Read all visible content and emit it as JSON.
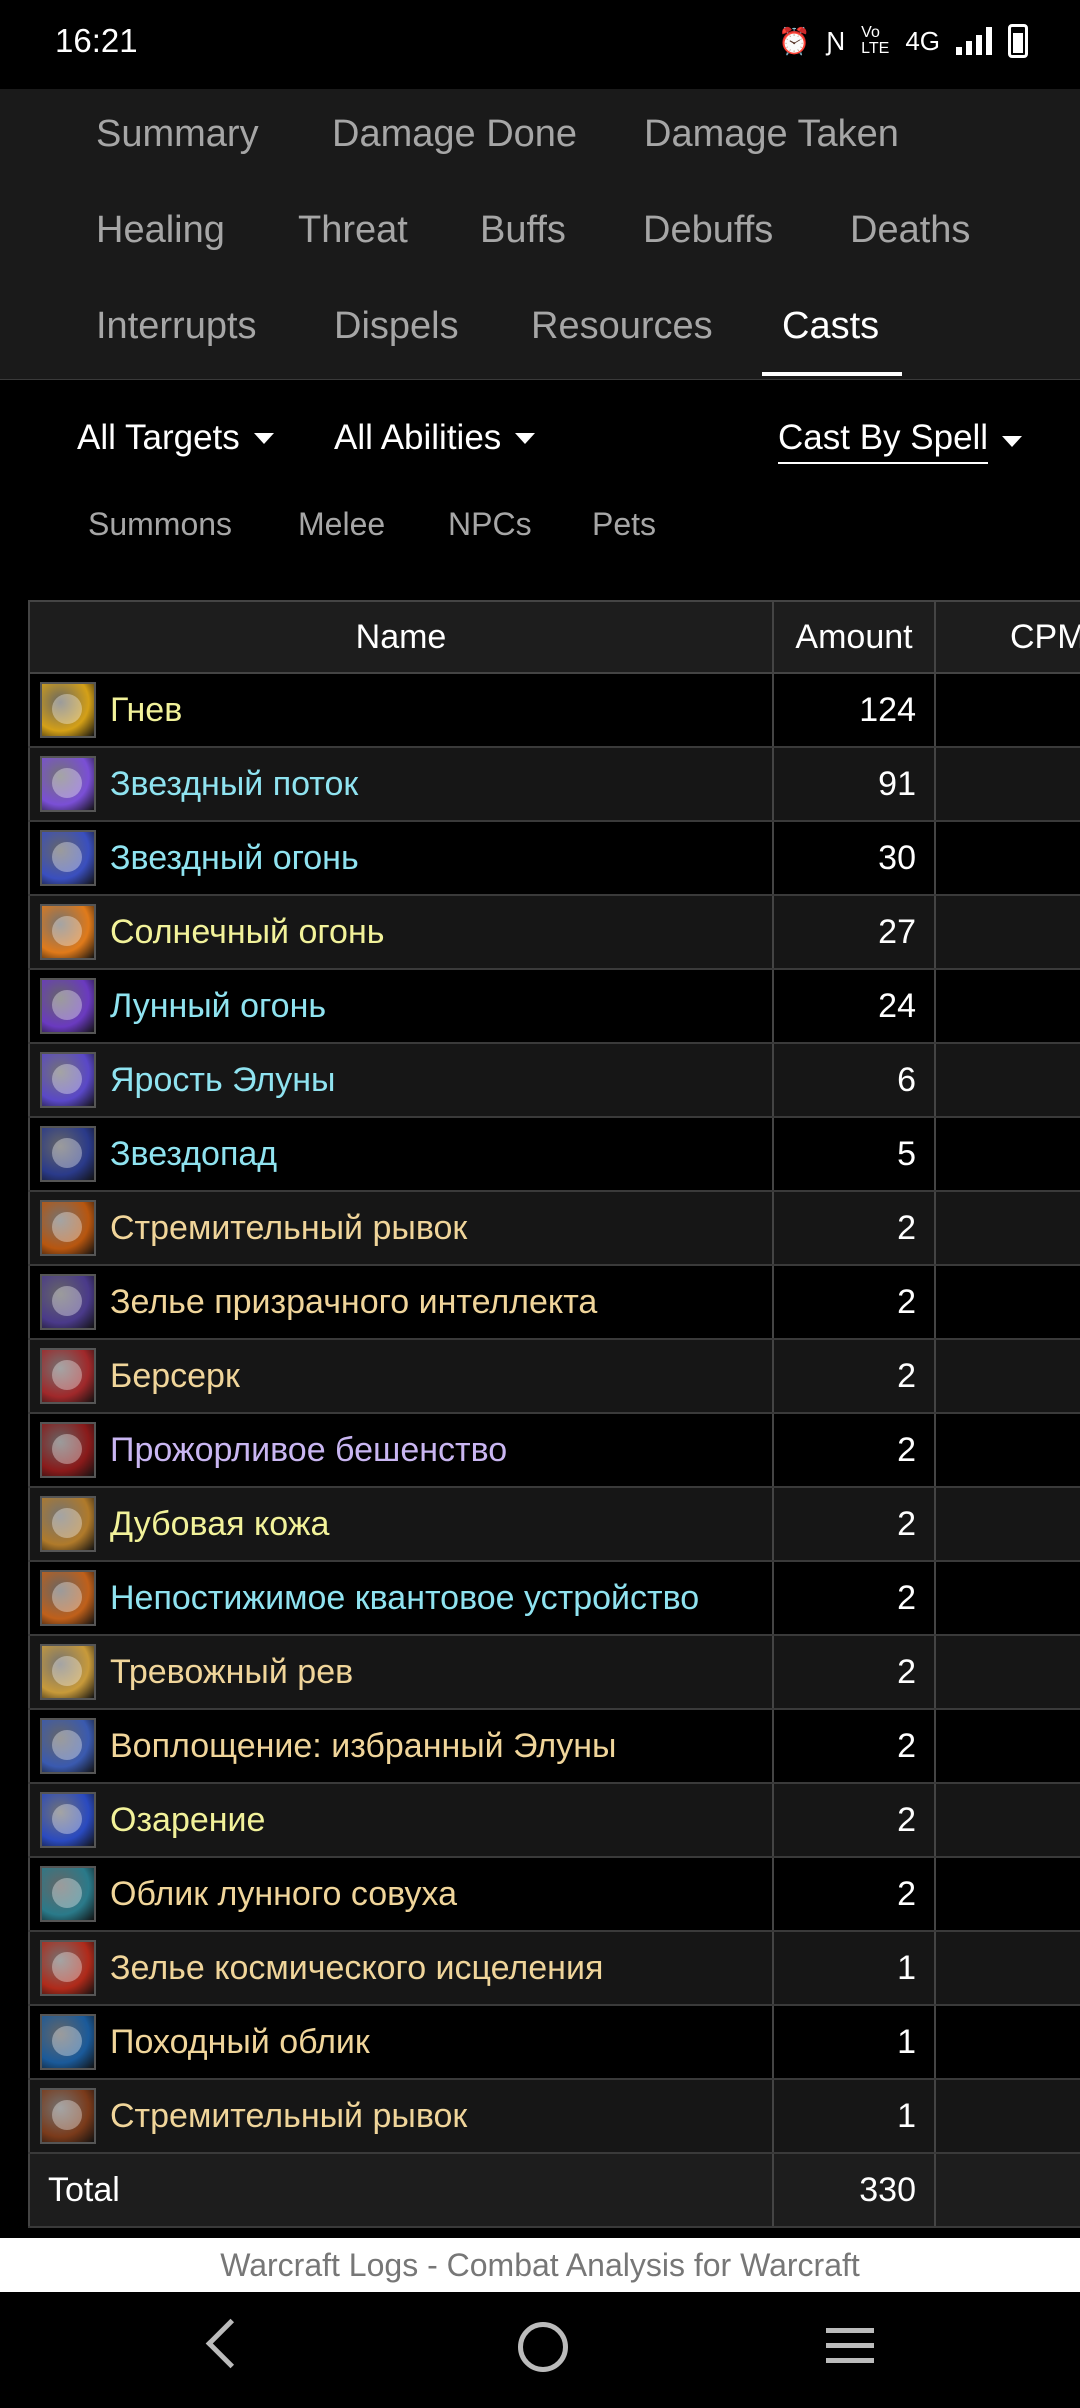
{
  "status_bar": {
    "time": "16:21",
    "network": "4G"
  },
  "tabs": [
    {
      "label": "Summary",
      "active": false
    },
    {
      "label": "Damage Done",
      "active": false
    },
    {
      "label": "Damage Taken",
      "active": false
    },
    {
      "label": "Healing",
      "active": false
    },
    {
      "label": "Threat",
      "active": false
    },
    {
      "label": "Buffs",
      "active": false
    },
    {
      "label": "Debuffs",
      "active": false
    },
    {
      "label": "Deaths",
      "active": false
    },
    {
      "label": "Interrupts",
      "active": false
    },
    {
      "label": "Dispels",
      "active": false
    },
    {
      "label": "Resources",
      "active": false
    },
    {
      "label": "Casts",
      "active": true
    }
  ],
  "filters": {
    "targets": "All Targets",
    "abilities": "All Abilities",
    "view": "Cast By Spell"
  },
  "subtabs": [
    "Summons",
    "Melee",
    "NPCs",
    "Pets"
  ],
  "table": {
    "headers": {
      "name": "Name",
      "amount": "Amount",
      "cpm": "CPM"
    },
    "rows": [
      {
        "name": "Гнев",
        "amount": "124",
        "color": "#f2f29a",
        "icon": "wrath-icon",
        "icon_color": "#d4a017"
      },
      {
        "name": "Звездный поток",
        "amount": "91",
        "color": "#8fe3f0",
        "icon": "starsurge-icon",
        "icon_color": "#7a4fd6"
      },
      {
        "name": "Звездный огонь",
        "amount": "30",
        "color": "#8fe3f0",
        "icon": "starfire-icon",
        "icon_color": "#3a4fbf"
      },
      {
        "name": "Солнечный огонь",
        "amount": "27",
        "color": "#f2f29a",
        "icon": "sunfire-icon",
        "icon_color": "#e07a1a"
      },
      {
        "name": "Лунный огонь",
        "amount": "24",
        "color": "#8fe3f0",
        "icon": "moonfire-icon",
        "icon_color": "#6a3ac0"
      },
      {
        "name": "Ярость Элуны",
        "amount": "6",
        "color": "#8fe3f0",
        "icon": "fury-of-elune-icon",
        "icon_color": "#5a48c8"
      },
      {
        "name": "Звездопад",
        "amount": "5",
        "color": "#8fe3f0",
        "icon": "starfall-icon",
        "icon_color": "#2a3a8a"
      },
      {
        "name": "Стремительный рывок",
        "amount": "2",
        "color": "#f0d59a",
        "icon": "dash-icon",
        "icon_color": "#b8560f"
      },
      {
        "name": "Зелье призрачного интеллекта",
        "amount": "2",
        "color": "#f0d59a",
        "icon": "potion-icon",
        "icon_color": "#4a3a8a"
      },
      {
        "name": "Берсерк",
        "amount": "2",
        "color": "#f0d59a",
        "icon": "berserk-icon",
        "icon_color": "#a0282a"
      },
      {
        "name": "Прожорливое бешенство",
        "amount": "2",
        "color": "#c9b6f2",
        "icon": "ravenous-frenzy-icon",
        "icon_color": "#8a1a1a"
      },
      {
        "name": "Дубовая кожа",
        "amount": "2",
        "color": "#f2f29a",
        "icon": "barkskin-icon",
        "icon_color": "#b07a2a"
      },
      {
        "name": "Непостижимое квантовое устройство",
        "amount": "2",
        "color": "#8fe3f0",
        "icon": "quantum-device-icon",
        "icon_color": "#c0601a"
      },
      {
        "name": "Тревожный рев",
        "amount": "2",
        "color": "#f0d59a",
        "icon": "stampeding-roar-icon",
        "icon_color": "#c89a3a"
      },
      {
        "name": "Воплощение: избранный Элуны",
        "amount": "2",
        "color": "#f0d59a",
        "icon": "incarnation-icon",
        "icon_color": "#3a5ab0"
      },
      {
        "name": "Озарение",
        "amount": "2",
        "color": "#f2f29a",
        "icon": "innervate-icon",
        "icon_color": "#2a4ac0"
      },
      {
        "name": "Облик лунного совуха",
        "amount": "2",
        "color": "#f0d59a",
        "icon": "moonkin-form-icon",
        "icon_color": "#2a7a8a"
      },
      {
        "name": "Зелье космического исцеления",
        "amount": "1",
        "color": "#f0d59a",
        "icon": "healing-potion-icon",
        "icon_color": "#b02a1a"
      },
      {
        "name": "Походный облик",
        "amount": "1",
        "color": "#f0d59a",
        "icon": "travel-form-icon",
        "icon_color": "#1a5a9a"
      },
      {
        "name": "Стремительный рывок",
        "amount": "1",
        "color": "#f0d59a",
        "icon": "stampede-icon",
        "icon_color": "#7a3a1a"
      }
    ],
    "total": {
      "label": "Total",
      "amount": "330"
    }
  },
  "footer": "Warcraft Logs - Combat Analysis for Warcraft"
}
